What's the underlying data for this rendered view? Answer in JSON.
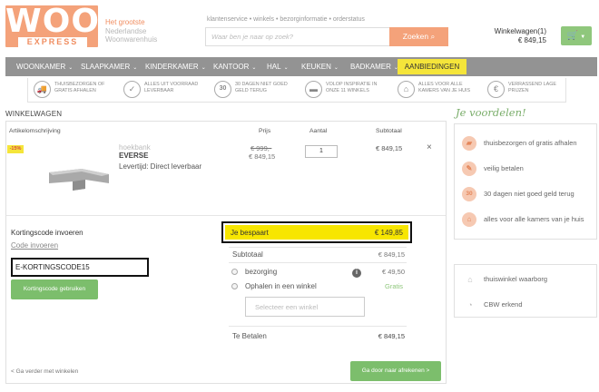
{
  "header": {
    "logo_top": "WOON",
    "logo_bottom": "EXPRESS",
    "tagline": [
      "Het grootste",
      "Nederlandse",
      "Woonwarenhuis"
    ],
    "top_links": "klantenservice • winkels • bezorginformatie • orderstatus",
    "search_placeholder": "Waar ben je naar op zoek?",
    "search_button": "Zoeken",
    "cart_label": "Winkelwagen(1)",
    "cart_total": "€ 849,15"
  },
  "nav": {
    "items": [
      "WOONKAMER",
      "SLAAPKAMER",
      "KINDERKAMER",
      "KANTOOR",
      "HAL",
      "KEUKEN",
      "BADKAMER"
    ],
    "offers": "AANBIEDINGEN"
  },
  "usps": [
    {
      "icon": "truck-icon",
      "glyph": "🚚",
      "text": "THUISBEZORGEN OF GRATIS AFHALEN"
    },
    {
      "icon": "check-icon",
      "glyph": "✓",
      "text": "ALLES UIT VOORRAAD LEVERBAAR"
    },
    {
      "icon": "thirty-days-icon",
      "glyph": "30",
      "text": "30 DAGEN NIET GOED GELD TERUG"
    },
    {
      "icon": "sofa-icon",
      "glyph": "▬",
      "text": "VOLOP INSPIRATIE IN ONZE 11 WINKELS"
    },
    {
      "icon": "home-icon",
      "glyph": "⌂",
      "text": "ALLES VOOR ALLE KAMERS VAN JE HUIS"
    },
    {
      "icon": "euro-icon",
      "glyph": "€",
      "text": "VERRASSEND LAGE PRIJZEN"
    }
  ],
  "cart": {
    "title": "WINKELWAGEN",
    "headers": {
      "desc": "Artikelomschrijving",
      "price": "Prijs",
      "qty": "Aantal",
      "subtotal": "Subtotaal"
    },
    "item": {
      "badge": "-15%",
      "type": "hoekbank",
      "name": "EVERSE",
      "delivery": "Levertijd: Direct leverbaar",
      "price_old": "€ 999,-",
      "price_new": "€ 849,15",
      "qty": "1",
      "subtotal": "€ 849,15",
      "remove": "×"
    },
    "discount": {
      "title": "Kortingscode invoeren",
      "link": "Code invoeren",
      "value": "E-KORTINGSCODE15",
      "button": "Kortingscode gebruiken"
    },
    "summary": {
      "savings_label": "Je bespaart",
      "savings_value": "€ 149,85",
      "subtotal_label": "Subtotaal",
      "subtotal_value": "€ 849,15",
      "delivery_label": "bezorging",
      "delivery_value": "€ 49,50",
      "pickup_label": "Ophalen in een winkel",
      "pickup_value": "Gratis",
      "store_placeholder": "Selecteer een winkel",
      "total_label": "Te Betalen",
      "total_value": "€ 849,15"
    },
    "back_link": "< Ga verder met winkelen",
    "checkout": "Ga door naar afrekenen >"
  },
  "benefits": {
    "title": "Je voordelen!",
    "items": [
      {
        "icon": "truck-icon",
        "glyph": "▰",
        "text": "thuisbezorgen of gratis afhalen"
      },
      {
        "icon": "secure-pay-icon",
        "glyph": "✎",
        "text": "veilig betalen"
      },
      {
        "icon": "thirty-days-icon",
        "glyph": "30",
        "text": "30 dagen niet goed geld terug"
      },
      {
        "icon": "home-icon",
        "glyph": "⌂",
        "text": "alles voor alle kamers van je huis"
      }
    ],
    "trust": [
      {
        "icon": "thuiswinkel-icon",
        "glyph": "⌂",
        "text": "thuiswinkel waarborg"
      },
      {
        "icon": "cbw-icon",
        "glyph": "◔",
        "text": "CBW erkend"
      }
    ]
  }
}
